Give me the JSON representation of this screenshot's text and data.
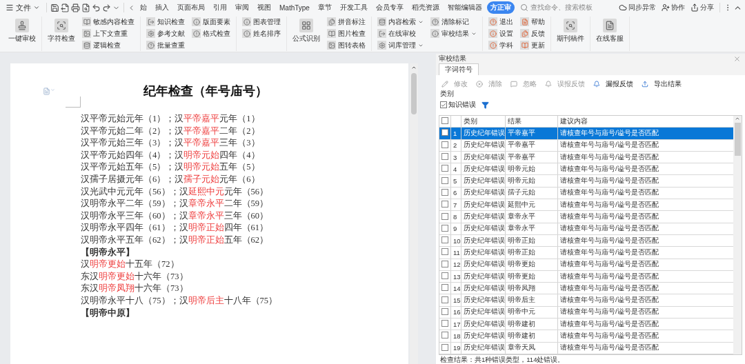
{
  "menu": {
    "label": "文件"
  },
  "tabs": [
    {
      "label": "始",
      "selected": false
    },
    {
      "label": "插入",
      "selected": false
    },
    {
      "label": "页面布局",
      "selected": false
    },
    {
      "label": "引用",
      "selected": false
    },
    {
      "label": "审阅",
      "selected": false
    },
    {
      "label": "视图",
      "selected": false
    },
    {
      "label": "MathType",
      "selected": false
    },
    {
      "label": "章节",
      "selected": false
    },
    {
      "label": "开发工具",
      "selected": false
    },
    {
      "label": "会员专享",
      "selected": false
    },
    {
      "label": "稻壳资源",
      "selected": false
    },
    {
      "label": "智能编辑器",
      "selected": false
    },
    {
      "label": "方正审",
      "selected": true
    }
  ],
  "search": {
    "placeholder": "查找命令、搜索模板"
  },
  "actions": [
    {
      "label": "同步异常",
      "kind": "cloud"
    },
    {
      "label": "协作",
      "kind": "people"
    },
    {
      "label": "分享",
      "kind": "share"
    }
  ],
  "ribbon": [
    {
      "items": [
        {
          "label": "一键审校",
          "kind": "large"
        }
      ]
    },
    {
      "items": [
        {
          "label": "字符检查",
          "kind": "large"
        },
        {
          "label": "敏感内容检查",
          "kind": "small",
          "dropdown": false
        },
        {
          "label": "上下文查重",
          "kind": "small",
          "dropdown": false
        },
        {
          "label": "逻辑检查",
          "kind": "small",
          "dropdown": false
        }
      ]
    },
    {
      "items": [
        {
          "label": "知识检查",
          "kind": "small",
          "dropdown": false
        },
        {
          "label": "参考文献",
          "kind": "small",
          "dropdown": false
        },
        {
          "label": "批量查重",
          "kind": "small",
          "dropdown": false
        },
        {
          "label": "版面要素",
          "kind": "small",
          "dropdown": false
        },
        {
          "label": "格式检查",
          "kind": "small",
          "dropdown": false
        }
      ]
    },
    {
      "items": [
        {
          "label": "图表管理",
          "kind": "small",
          "dropdown": false
        },
        {
          "label": "姓名排序",
          "kind": "small",
          "dropdown": false
        }
      ]
    },
    {
      "items": [
        {
          "label": "公式识别",
          "kind": "large"
        },
        {
          "label": "拼音标注",
          "kind": "small",
          "dropdown": false
        },
        {
          "label": "图片检查",
          "kind": "small",
          "dropdown": false
        },
        {
          "label": "图转表格",
          "kind": "small",
          "dropdown": false
        }
      ]
    },
    {
      "items": [
        {
          "label": "内容检索",
          "kind": "small",
          "dropdown": true
        },
        {
          "label": "在线审校",
          "kind": "small",
          "dropdown": false
        },
        {
          "label": "词库管理",
          "kind": "small",
          "dropdown": true
        },
        {
          "label": "清除标记",
          "kind": "small",
          "dropdown": false
        },
        {
          "label": "审校结果",
          "kind": "small",
          "dropdown": true
        }
      ]
    },
    {
      "items": [
        {
          "label": "退出",
          "kind": "small",
          "dropdown": false
        },
        {
          "label": "设置",
          "kind": "small",
          "dropdown": false
        },
        {
          "label": "学科",
          "kind": "small",
          "dropdown": false
        },
        {
          "label": "帮助",
          "kind": "small",
          "dropdown": false
        },
        {
          "label": "反馈",
          "kind": "small",
          "dropdown": false
        },
        {
          "label": "更新",
          "kind": "small",
          "dropdown": false
        }
      ]
    },
    {
      "items": [
        {
          "label": "期刊稿件",
          "kind": "large"
        }
      ]
    },
    {
      "items": [
        {
          "label": "在线客服",
          "kind": "large"
        }
      ]
    }
  ],
  "document": {
    "title": "纪年检查（年号庙号）",
    "lines": [
      {
        "kind": "text",
        "segments": [
          {
            "text": "汉平帝元始元年（1）；汉",
            "flagged": false
          },
          {
            "text": "平帝嘉平",
            "flagged": true
          },
          {
            "text": "元年（1）",
            "flagged": false
          }
        ]
      },
      {
        "kind": "text",
        "segments": [
          {
            "text": "汉平帝元始二年（2）；汉",
            "flagged": false
          },
          {
            "text": "平帝嘉平",
            "flagged": true
          },
          {
            "text": "二年（2）",
            "flagged": false
          }
        ]
      },
      {
        "kind": "text",
        "segments": [
          {
            "text": "汉平帝元始三年（3）；汉",
            "flagged": false
          },
          {
            "text": "平帝嘉平",
            "flagged": true
          },
          {
            "text": "三年（3）",
            "flagged": false
          }
        ]
      },
      {
        "kind": "text",
        "segments": [
          {
            "text": "汉平帝元始四年（4）；汉",
            "flagged": false
          },
          {
            "text": "明帝元始",
            "flagged": true
          },
          {
            "text": "四年（4）",
            "flagged": false
          }
        ]
      },
      {
        "kind": "text",
        "segments": [
          {
            "text": "汉平帝元始五年（5）；汉",
            "flagged": false
          },
          {
            "text": "明帝元始",
            "flagged": true
          },
          {
            "text": "五年（5）",
            "flagged": false
          }
        ]
      },
      {
        "kind": "text",
        "segments": [
          {
            "text": "汉孺子居摄元年（6）；汉",
            "flagged": false
          },
          {
            "text": "孺子元始",
            "flagged": true
          },
          {
            "text": "元年（6）",
            "flagged": false
          }
        ]
      },
      {
        "kind": "text",
        "segments": [
          {
            "text": "汉光武中元元年（56）；汉",
            "flagged": false
          },
          {
            "text": "延熙中元",
            "flagged": true
          },
          {
            "text": "元年（56）",
            "flagged": false
          }
        ]
      },
      {
        "kind": "text",
        "segments": [
          {
            "text": "汉明帝永平二年（59）；汉",
            "flagged": false
          },
          {
            "text": "章帝永平",
            "flagged": true
          },
          {
            "text": "二年（59）",
            "flagged": false
          }
        ]
      },
      {
        "kind": "text",
        "segments": [
          {
            "text": "汉明帝永平三年（60）；汉",
            "flagged": false
          },
          {
            "text": "章帝永平",
            "flagged": true
          },
          {
            "text": "三年（60）",
            "flagged": false
          }
        ]
      },
      {
        "kind": "text",
        "segments": [
          {
            "text": "汉明帝永平四年（61）；汉",
            "flagged": false
          },
          {
            "text": "明帝正始",
            "flagged": true
          },
          {
            "text": "四年（61）",
            "flagged": false
          }
        ]
      },
      {
        "kind": "text",
        "segments": [
          {
            "text": "汉明帝永平五年（62）；汉",
            "flagged": false
          },
          {
            "text": "明帝正始",
            "flagged": true
          },
          {
            "text": "五年（62）",
            "flagged": false
          }
        ]
      },
      {
        "kind": "heading",
        "segments": [
          {
            "text": "【明帝永平】",
            "flagged": false
          }
        ]
      },
      {
        "kind": "text",
        "segments": [
          {
            "text": "汉",
            "flagged": false
          },
          {
            "text": "明帝更始",
            "flagged": true
          },
          {
            "text": "十五年（72）",
            "flagged": false
          }
        ]
      },
      {
        "kind": "text",
        "segments": [
          {
            "text": "东汉",
            "flagged": false
          },
          {
            "text": "明帝更始",
            "flagged": true
          },
          {
            "text": "十六年（73）",
            "flagged": false
          }
        ]
      },
      {
        "kind": "text",
        "segments": [
          {
            "text": "东汉",
            "flagged": false
          },
          {
            "text": "明帝凤翔",
            "flagged": true
          },
          {
            "text": "十六年（73）",
            "flagged": false
          }
        ]
      },
      {
        "kind": "text",
        "segments": [
          {
            "text": "汉明帝永平十八（75）；汉",
            "flagged": false
          },
          {
            "text": "明帝后主",
            "flagged": true
          },
          {
            "text": "十八年（75）",
            "flagged": false
          }
        ]
      },
      {
        "kind": "heading",
        "segments": [
          {
            "text": "【明帝中原】",
            "flagged": false
          }
        ]
      }
    ]
  },
  "panel": {
    "title": "审校结果",
    "tab": {
      "label": "字词符号",
      "selected": true
    },
    "tools": [
      {
        "label": "修改",
        "disabled": true
      },
      {
        "label": "清除",
        "disabled": true
      },
      {
        "label": "忽略",
        "disabled": true
      },
      {
        "label": "误报反馈",
        "disabled": true
      },
      {
        "label": "漏报反馈",
        "disabled": false
      },
      {
        "label": "导出结果",
        "disabled": false
      }
    ],
    "category_label": "类别",
    "category": {
      "label": "知识错误",
      "checked": true
    },
    "select_all": {
      "checked": false
    },
    "columns": [
      "类别",
      "结果",
      "建议内容"
    ],
    "rows": [
      {
        "index": "1",
        "category": "历史纪年错误",
        "result": "平帝嘉平",
        "suggestion": "请核查年号与庙号/谥号是否匹配",
        "selected": true,
        "checked": false
      },
      {
        "index": "2",
        "category": "历史纪年错误",
        "result": "平帝嘉平",
        "suggestion": "请核查年号与庙号/谥号是否匹配",
        "selected": false,
        "checked": false
      },
      {
        "index": "3",
        "category": "历史纪年错误",
        "result": "平帝嘉平",
        "suggestion": "请核查年号与庙号/谥号是否匹配",
        "selected": false,
        "checked": false
      },
      {
        "index": "4",
        "category": "历史纪年错误",
        "result": "明帝元始",
        "suggestion": "请核查年号与庙号/谥号是否匹配",
        "selected": false,
        "checked": false
      },
      {
        "index": "5",
        "category": "历史纪年错误",
        "result": "明帝元始",
        "suggestion": "请核查年号与庙号/谥号是否匹配",
        "selected": false,
        "checked": false
      },
      {
        "index": "6",
        "category": "历史纪年错误",
        "result": "孺子元始",
        "suggestion": "请核查年号与庙号/谥号是否匹配",
        "selected": false,
        "checked": false
      },
      {
        "index": "7",
        "category": "历史纪年错误",
        "result": "延熙中元",
        "suggestion": "请核查年号与庙号/谥号是否匹配",
        "selected": false,
        "checked": false
      },
      {
        "index": "8",
        "category": "历史纪年错误",
        "result": "章帝永平",
        "suggestion": "请核查年号与庙号/谥号是否匹配",
        "selected": false,
        "checked": false
      },
      {
        "index": "9",
        "category": "历史纪年错误",
        "result": "章帝永平",
        "suggestion": "请核查年号与庙号/谥号是否匹配",
        "selected": false,
        "checked": false
      },
      {
        "index": "10",
        "category": "历史纪年错误",
        "result": "明帝正始",
        "suggestion": "请核查年号与庙号/谥号是否匹配",
        "selected": false,
        "checked": false
      },
      {
        "index": "11",
        "category": "历史纪年错误",
        "result": "明帝正始",
        "suggestion": "请核查年号与庙号/谥号是否匹配",
        "selected": false,
        "checked": false
      },
      {
        "index": "12",
        "category": "历史纪年错误",
        "result": "明帝更始",
        "suggestion": "请核查年号与庙号/谥号是否匹配",
        "selected": false,
        "checked": false
      },
      {
        "index": "13",
        "category": "历史纪年错误",
        "result": "明帝更始",
        "suggestion": "请核查年号与庙号/谥号是否匹配",
        "selected": false,
        "checked": false
      },
      {
        "index": "14",
        "category": "历史纪年错误",
        "result": "明帝凤翔",
        "suggestion": "请核查年号与庙号/谥号是否匹配",
        "selected": false,
        "checked": false
      },
      {
        "index": "15",
        "category": "历史纪年错误",
        "result": "明帝后主",
        "suggestion": "请核查年号与庙号/谥号是否匹配",
        "selected": false,
        "checked": false
      },
      {
        "index": "16",
        "category": "历史纪年错误",
        "result": "明帝中元",
        "suggestion": "请核查年号与庙号/谥号是否匹配",
        "selected": false,
        "checked": false
      },
      {
        "index": "17",
        "category": "历史纪年错误",
        "result": "明帝建初",
        "suggestion": "请核查年号与庙号/谥号是否匹配",
        "selected": false,
        "checked": false
      },
      {
        "index": "18",
        "category": "历史纪年错误",
        "result": "明帝建初",
        "suggestion": "请核查年号与庙号/谥号是否匹配",
        "selected": false,
        "checked": false
      },
      {
        "index": "19",
        "category": "历史纪年错误",
        "result": "章帝天凤",
        "suggestion": "请核查年号与庙号/谥号是否匹配",
        "selected": false,
        "checked": false
      }
    ],
    "status": "检查结果：共1种错误类型，114处错误。"
  }
}
